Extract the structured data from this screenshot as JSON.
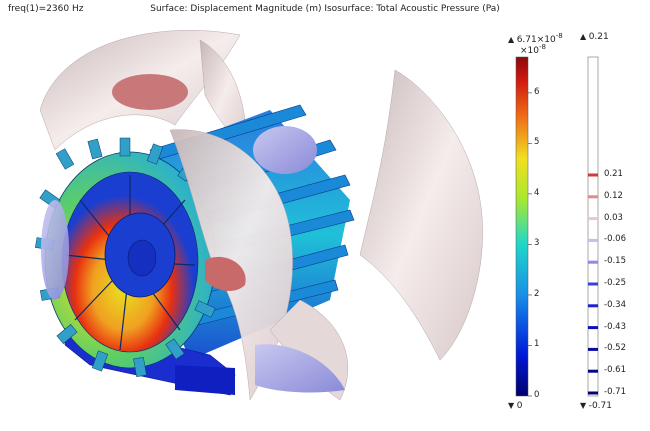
{
  "header": {
    "freq_label": "freq(1)=2360 Hz",
    "title": "Surface: Displacement Magnitude (m) Isosurface: Total Acoustic Pressure (Pa)"
  },
  "surface_colorbar": {
    "max_label": "6.71×10",
    "max_exp": "-8",
    "multiplier": "×10",
    "multiplier_exp": "-8",
    "min_label": "0",
    "ticks": [
      "6",
      "5",
      "4",
      "3",
      "2",
      "1",
      "0"
    ],
    "colormap": "rainbow"
  },
  "isosurface_colorbar": {
    "max_label": "0.21",
    "min_label": "-0.71",
    "levels": [
      "0.21",
      "0.12",
      "0.03",
      "-0.06",
      "-0.15",
      "-0.25",
      "-0.34",
      "-0.43",
      "-0.52",
      "-0.61",
      "-0.71"
    ],
    "level_colors": [
      "#d03a3a",
      "#e08a8a",
      "#e8c8c8",
      "#c0c0e8",
      "#8a8ae8",
      "#3c3ce0",
      "#2020d0",
      "#1010b8",
      "#0a0aa0",
      "#060686",
      "#03036c"
    ]
  },
  "colors": {
    "motor_blue": "#1a3fd0",
    "iso_light": "#e6d8d8",
    "iso_red": "#c86464",
    "iso_blue": "#9a9ae0"
  }
}
